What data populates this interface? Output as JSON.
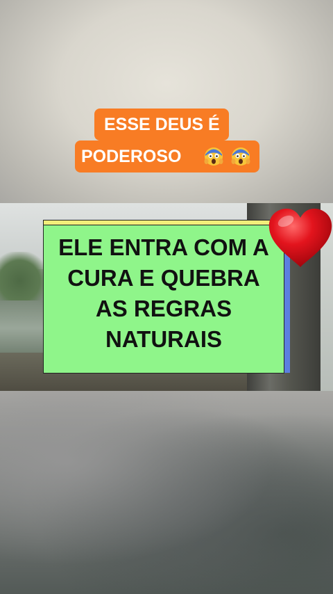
{
  "caption": {
    "line1": "ESSE DEUS É",
    "line2": "PODEROSO",
    "emoji": [
      "screaming-face-emoji",
      "screaming-face-emoji"
    ]
  },
  "card": {
    "lines": [
      "ELE ENTRA COM A",
      "CURA E QUEBRA",
      "AS REGRAS",
      "NATURAIS"
    ]
  },
  "colors": {
    "caption_bg": "#f87c24",
    "card_bg": "#8ff58a",
    "card_shadow": "#5b7fe0",
    "card_top": "#f1ee7a",
    "heart": "#e0131c"
  }
}
